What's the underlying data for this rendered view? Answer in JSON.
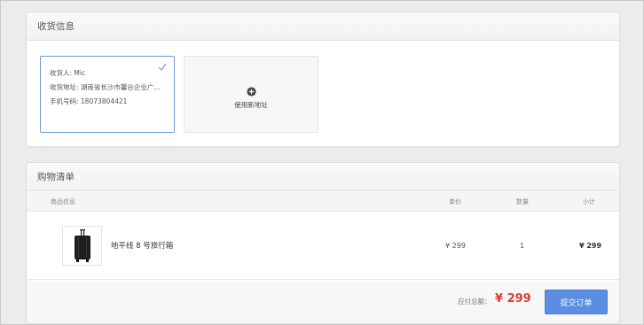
{
  "shipping": {
    "title": "收货信息",
    "address_card": {
      "recipient": "收货人: Mic",
      "address": "收货地址: 湖南省长沙市馨谷企业广...",
      "phone": "手机号码: 18073804421"
    },
    "new_address_label": "使用新地址"
  },
  "cart": {
    "title": "购物清单",
    "columns": {
      "product": "商品信息",
      "unit_price": "单价",
      "quantity": "数量",
      "subtotal": "小计"
    },
    "items": [
      {
        "name": "地平线 8 号旅行箱",
        "unit_price": "¥ 299",
        "quantity": "1",
        "subtotal": "¥ 299"
      }
    ]
  },
  "summary": {
    "total_label": "应付总额：",
    "total_value": "¥ 299",
    "submit_label": "提交订单"
  },
  "colors": {
    "accent": "#5b8de0",
    "price": "#e03d35",
    "selected_border": "#6f97d9"
  }
}
